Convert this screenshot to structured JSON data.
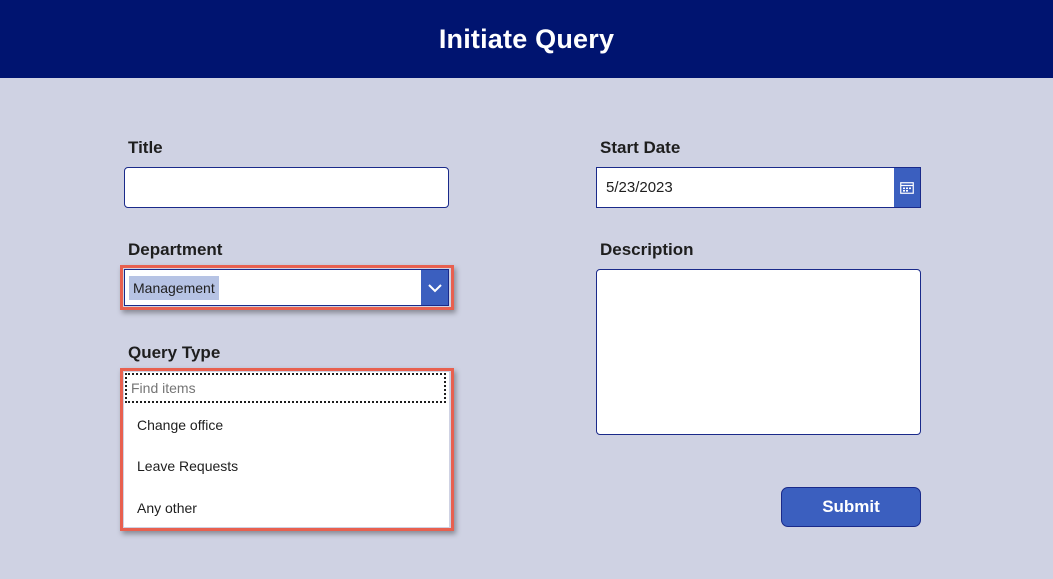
{
  "header": {
    "title": "Initiate Query"
  },
  "form": {
    "title": {
      "label": "Title",
      "value": ""
    },
    "start_date": {
      "label": "Start Date",
      "value": "5/23/2023",
      "icon": "calendar-icon"
    },
    "department": {
      "label": "Department",
      "selected": "Management",
      "icon": "chevron-down-icon"
    },
    "description": {
      "label": "Description",
      "value": ""
    },
    "query_type": {
      "label": "Query Type",
      "search_placeholder": "Find items",
      "options": [
        "Change office",
        "Leave Requests",
        "Any other"
      ]
    },
    "submit_label": "Submit"
  },
  "colors": {
    "header_bg": "#001470",
    "page_bg": "#cfd2e3",
    "accent": "#3b5fbf",
    "highlight_border": "#e8604f",
    "selected_bg": "#b6c3e4"
  }
}
